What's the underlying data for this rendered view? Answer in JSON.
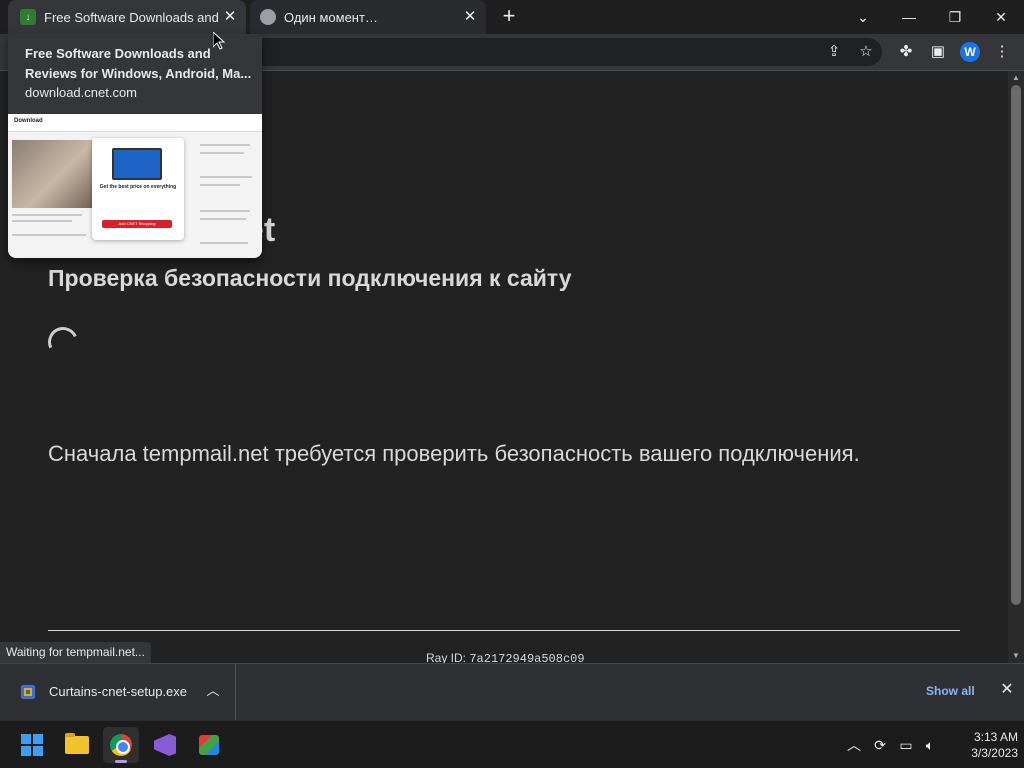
{
  "browser": {
    "tabs": [
      {
        "title": "Free Software Downloads and Re",
        "favicon": "cnet-download-icon",
        "active": true
      },
      {
        "title": "Один момент…",
        "favicon": "globe-icon",
        "active": false
      }
    ],
    "new_tab_symbol": "+",
    "window_controls": {
      "dropdown": "⌄",
      "minimize": "—",
      "restore": "❐",
      "close": "✕"
    },
    "profile_initial": "W"
  },
  "hover_card": {
    "title": "Free Software Downloads and Reviews for Windows, Android, Ma...",
    "url": "download.cnet.com",
    "thumbnail": {
      "logo": "Download",
      "popup_headline": "Get the best price on everything",
      "popup_button": "Add CNET Shopping"
    }
  },
  "page": {
    "site_title": "et",
    "heading": "Проверка безопасности подключения к сайту",
    "message": "Сначала tempmail.net требуется проверить безопасность вашего подключения.",
    "ray_label": "Ray ID: ",
    "ray_value": "7a2172949a508c09"
  },
  "status_bubble": "Waiting for tempmail.net...",
  "downloads": {
    "items": [
      {
        "name": "Curtains-cnet-setup.exe"
      }
    ],
    "show_all": "Show all"
  },
  "taskbar": {
    "apps": [
      "start-button",
      "file-explorer",
      "chrome",
      "visual-studio",
      "color-app"
    ],
    "clock": {
      "time": "3:13 AM",
      "date": "3/3/2023"
    }
  },
  "colors": {
    "page_bg": "#222222",
    "text": "#d9d9d9",
    "accent_link": "#8ab4f8",
    "toolbar": "#35363a"
  }
}
